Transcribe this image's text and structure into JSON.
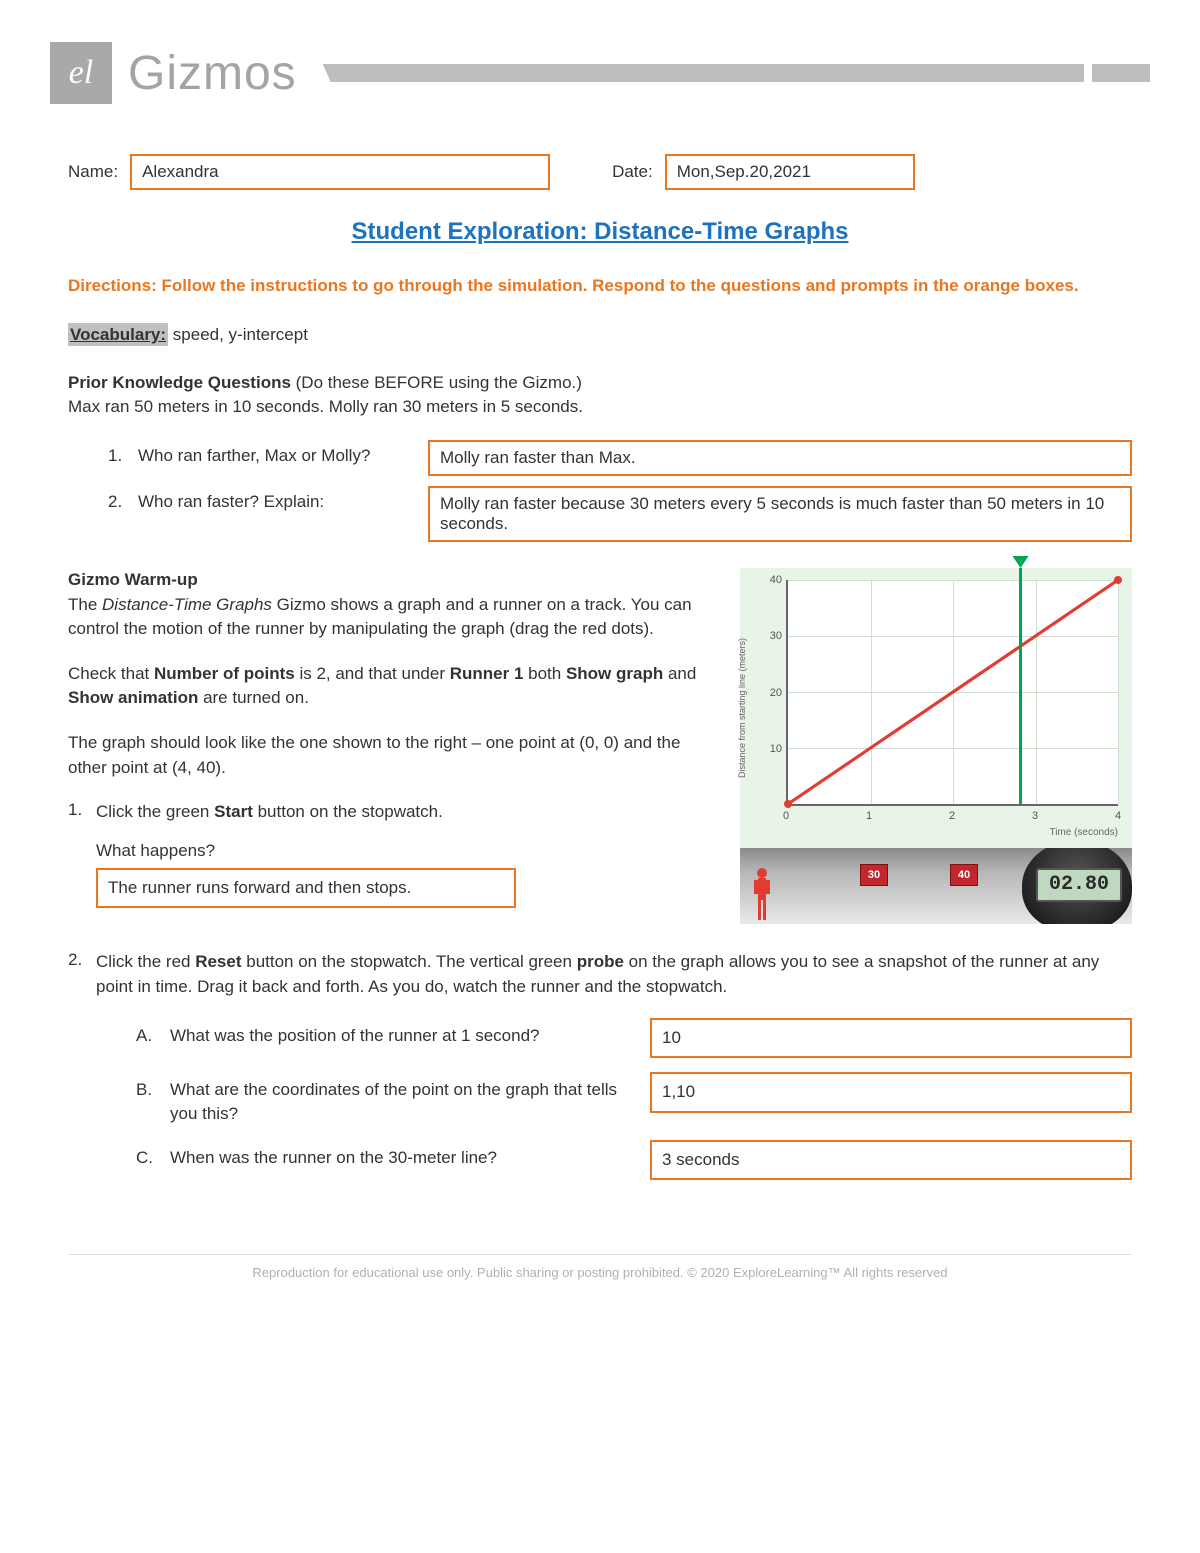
{
  "header": {
    "logo_text": "el",
    "brand": "Gizmos"
  },
  "form": {
    "name_label": "Name:",
    "name_value": "Alexandra",
    "date_label": "Date:",
    "date_value": "Mon,Sep.20,2021"
  },
  "title": "Student Exploration: Distance-Time Graphs",
  "directions": "Directions: Follow the instructions to go through the simulation. Respond to the questions and prompts in the orange boxes.",
  "vocab": {
    "label": "Vocabulary:",
    "text": " speed, y-intercept"
  },
  "prior": {
    "heading": "Prior Knowledge Questions ",
    "note": "(Do these BEFORE using the Gizmo.)",
    "context": "Max ran 50 meters in 10 seconds. Molly ran 30 meters in 5 seconds.",
    "q1": {
      "num": "1.",
      "text": "Who ran farther, Max or Molly?",
      "ans": "Molly ran faster than Max."
    },
    "q2": {
      "num": "2.",
      "text": "Who ran faster? Explain:",
      "ans": "Molly ran faster because 30 meters every 5 seconds is much faster than 50 meters in 10 seconds."
    }
  },
  "warmup": {
    "heading": "Gizmo Warm-up",
    "p1a": "The ",
    "p1b": "Distance-Time Graphs",
    "p1c": " Gizmo shows a graph and a runner on a track. You can control the motion of the runner by manipulating the graph (drag the red dots).",
    "p2a": "Check that ",
    "p2b": "Number of points",
    "p2c": " is 2, and that under ",
    "p2d": "Runner 1",
    "p2e": " both ",
    "p2f": "Show graph",
    "p2g": " and ",
    "p2h": "Show animation",
    "p2i": " are turned on.",
    "p3": "The graph should look like the one shown to the right – one point at (0, 0) and the other point at (4, 40).",
    "step1": {
      "num": "1.",
      "text_a": "Click the green ",
      "text_b": "Start",
      "text_c": " button on the stopwatch.",
      "what": "What happens?",
      "ans": "The runner runs forward and then stops."
    },
    "step2": {
      "num": "2.",
      "text_a": "Click the red ",
      "text_b": "Reset",
      "text_c": " button on the stopwatch. The vertical green ",
      "text_d": "probe",
      "text_e": " on the graph allows you to see a snapshot of the runner at any point in time. Drag it back and forth. As you do, watch the runner and the stopwatch.",
      "A": {
        "letter": "A.",
        "text": "What was the position of the runner at 1 second?",
        "ans": "10"
      },
      "B": {
        "letter": "B.",
        "text": "What are the coordinates of the point on the graph that tells you this?",
        "ans": "1,10"
      },
      "C": {
        "letter": "C.",
        "text": "When was the runner on the 30-meter line?",
        "ans": "3 seconds"
      }
    }
  },
  "chart_data": {
    "type": "line",
    "title": "",
    "xlabel": "Time (seconds)",
    "ylabel": "Distance from starting line (meters)",
    "xlim": [
      0,
      4
    ],
    "ylim": [
      0,
      40
    ],
    "x_ticks": [
      0,
      1,
      2,
      3,
      4
    ],
    "y_ticks": [
      0,
      10,
      20,
      30,
      40
    ],
    "series": [
      {
        "name": "Runner 1",
        "color": "#E03C31",
        "x": [
          0,
          4
        ],
        "y": [
          0,
          40
        ]
      }
    ],
    "probe_x": 2.8,
    "stopwatch": "02.80",
    "track_markers": [
      30,
      40
    ]
  },
  "footer": "Reproduction for educational use only. Public sharing or posting prohibited. © 2020 ExploreLearning™ All rights reserved"
}
